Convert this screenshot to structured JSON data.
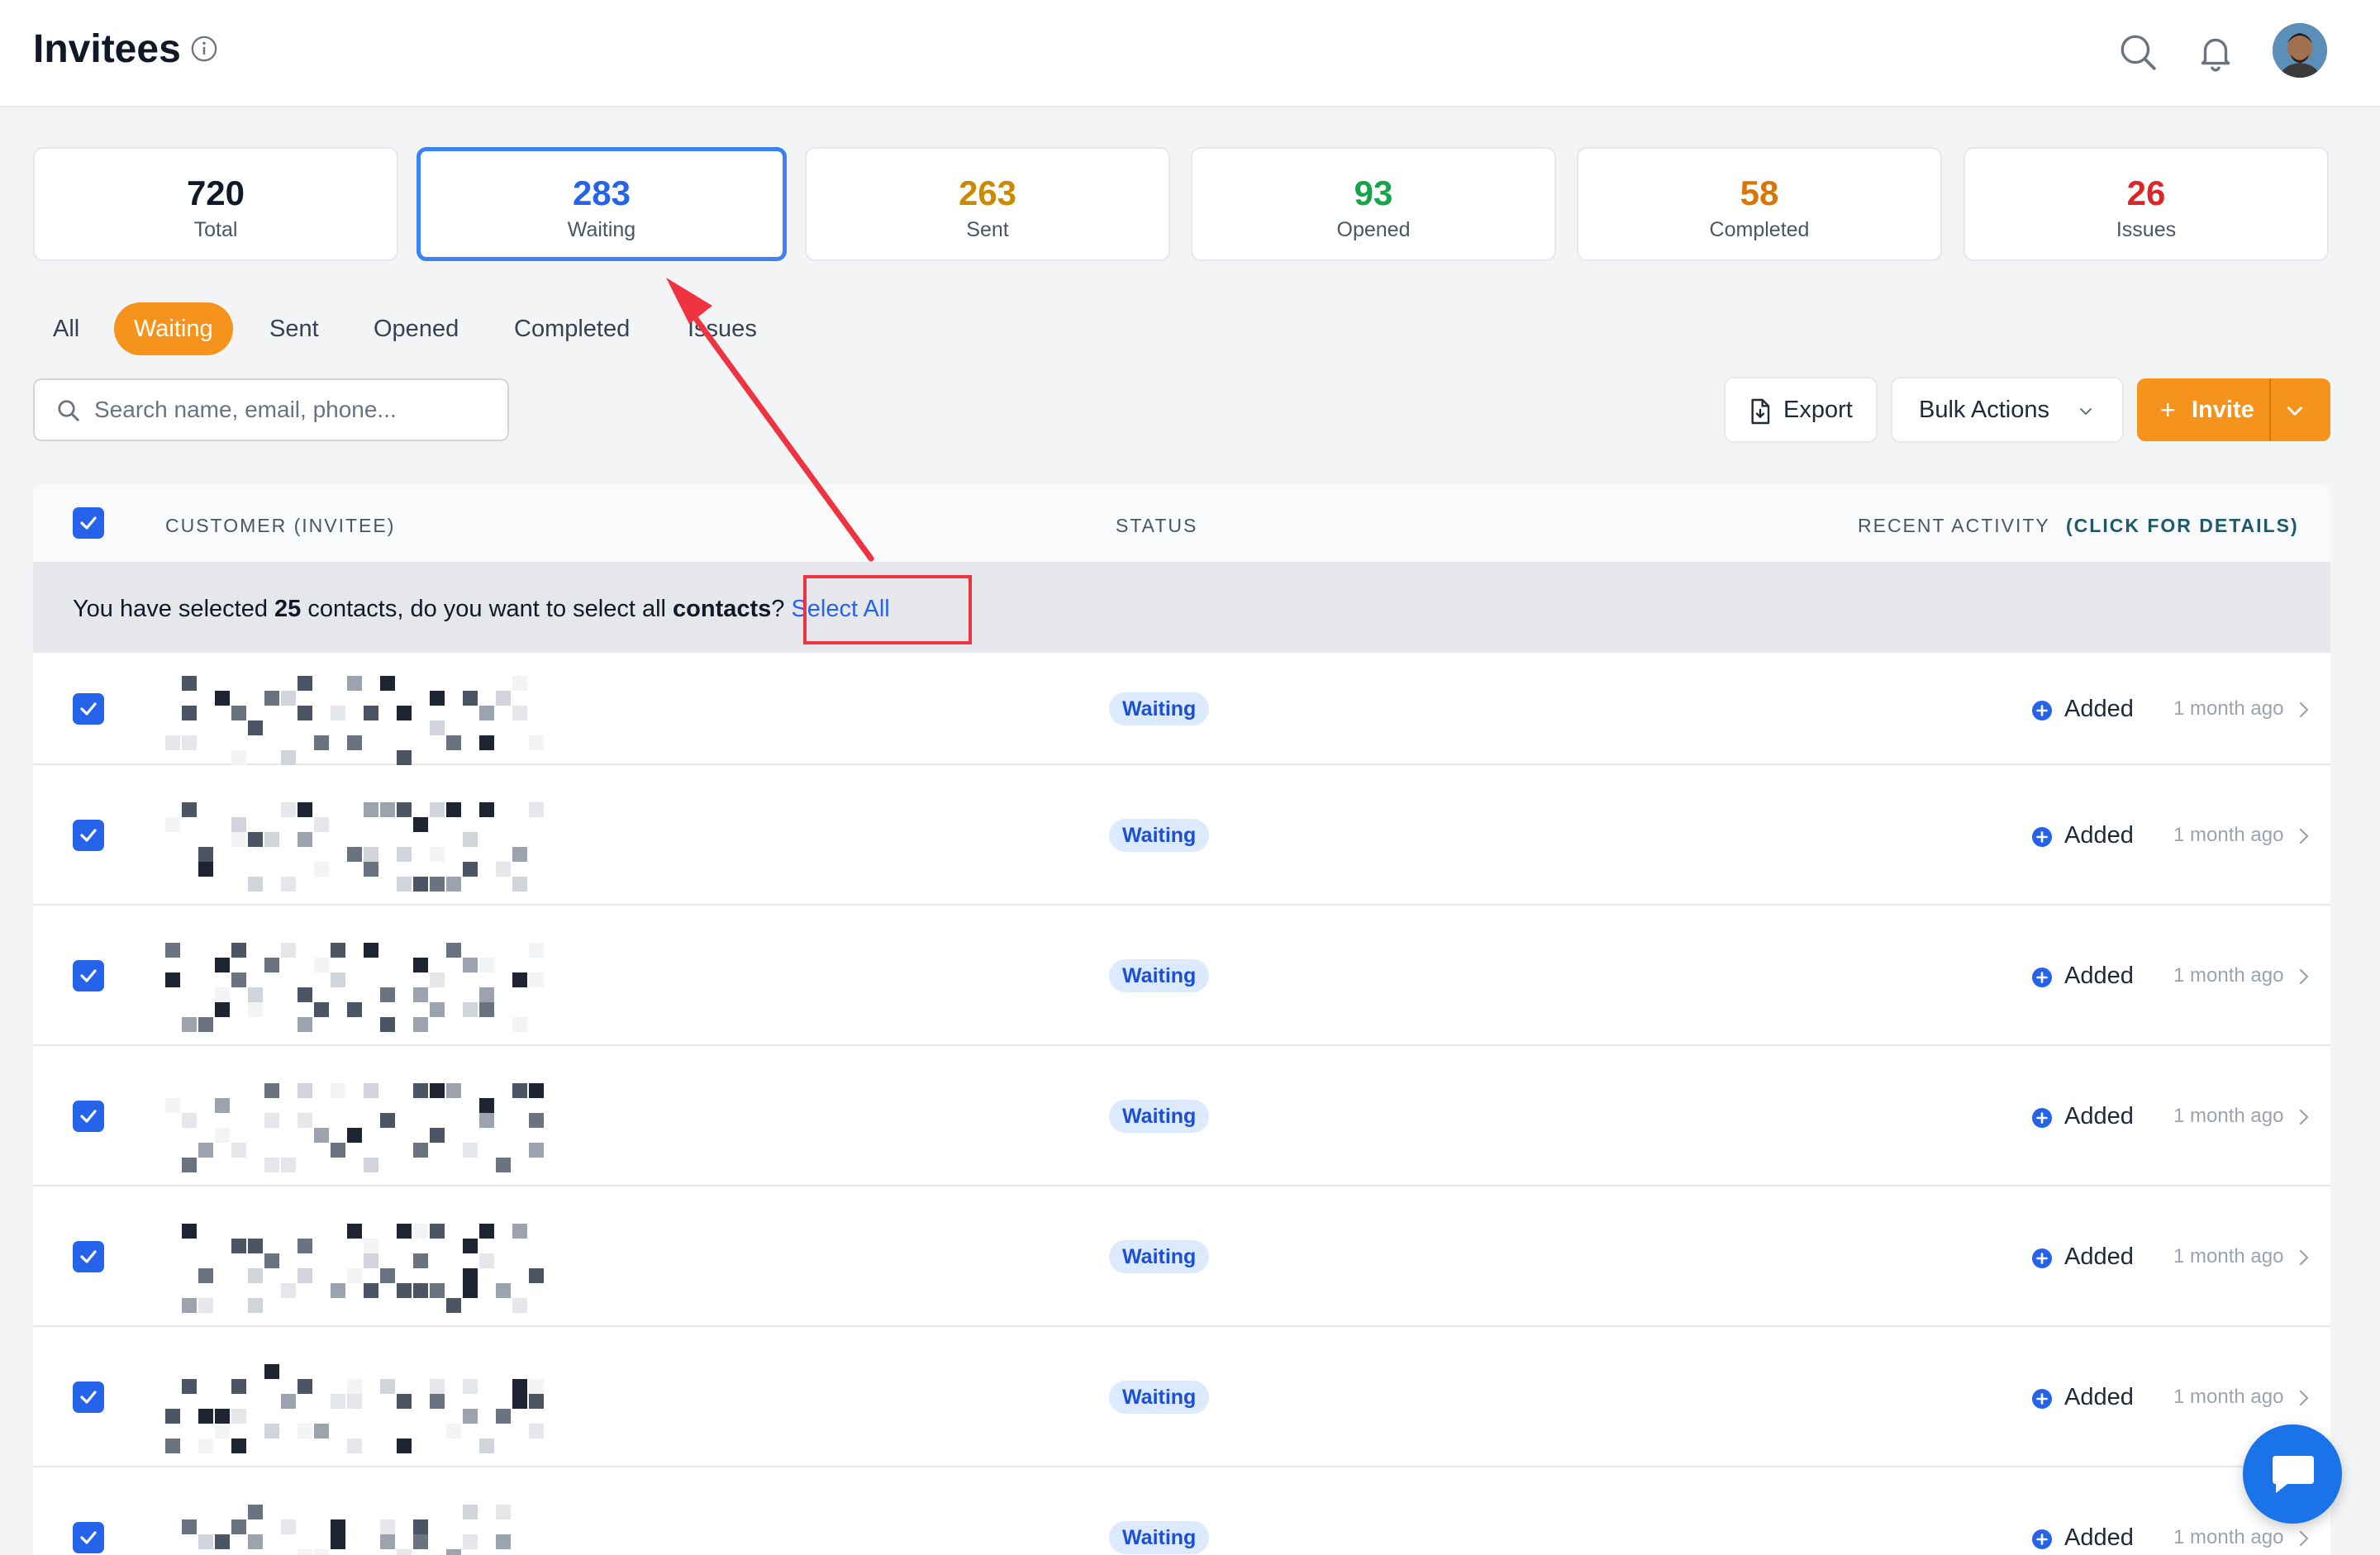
{
  "header": {
    "title": "Invitees"
  },
  "stats": [
    {
      "value": "720",
      "label": "Total",
      "color": "#111827"
    },
    {
      "value": "283",
      "label": "Waiting",
      "color": "#2563eb"
    },
    {
      "value": "263",
      "label": "Sent",
      "color": "#ca8a04"
    },
    {
      "value": "93",
      "label": "Opened",
      "color": "#16a34a"
    },
    {
      "value": "58",
      "label": "Completed",
      "color": "#d97706"
    },
    {
      "value": "26",
      "label": "Issues",
      "color": "#dc2626"
    }
  ],
  "tabs": [
    "All",
    "Waiting",
    "Sent",
    "Opened",
    "Completed",
    "Issues"
  ],
  "active_tab": "Waiting",
  "search": {
    "placeholder": "Search name, email, phone..."
  },
  "toolbar": {
    "export_label": "Export",
    "bulk_label": "Bulk Actions",
    "invite_label": "Invite"
  },
  "table": {
    "col_customer": "CUSTOMER (INVITEE)",
    "col_status": "STATUS",
    "col_activity": "RECENT ACTIVITY",
    "col_activity_link": "(CLICK FOR DETAILS)",
    "banner": {
      "pre": "You have selected ",
      "count": "25",
      "mid": " contacts, do you want to select all ",
      "bold": "contacts",
      "post": "?",
      "link": "Select All"
    },
    "rows": [
      {
        "status": "Waiting",
        "activity": "Added",
        "time": "1 month ago"
      },
      {
        "status": "Waiting",
        "activity": "Added",
        "time": "1 month ago"
      },
      {
        "status": "Waiting",
        "activity": "Added",
        "time": "1 month ago"
      },
      {
        "status": "Waiting",
        "activity": "Added",
        "time": "1 month ago"
      },
      {
        "status": "Waiting",
        "activity": "Added",
        "time": "1 month ago"
      },
      {
        "status": "Waiting",
        "activity": "Added",
        "time": "1 month ago"
      },
      {
        "status": "Waiting",
        "activity": "Added",
        "time": "1 month ago"
      }
    ]
  },
  "colors": {
    "accent_orange": "#f6931d",
    "primary_blue": "#2563eb",
    "annotation_red": "#ef3340"
  }
}
